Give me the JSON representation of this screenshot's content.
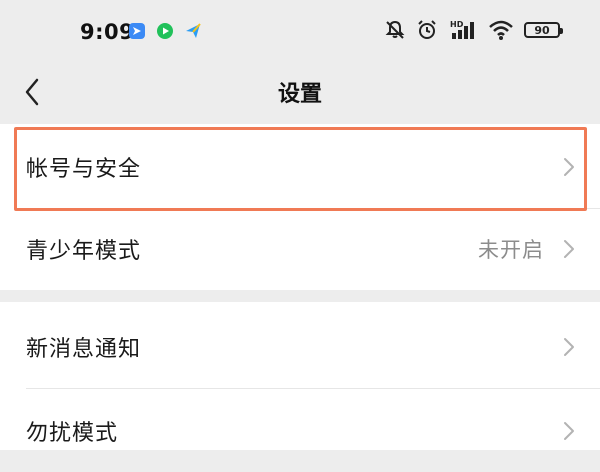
{
  "status_bar": {
    "time": "9:09",
    "battery": "90",
    "hd_label": "HD"
  },
  "nav": {
    "title": "设置"
  },
  "sections": [
    {
      "items": [
        {
          "label": "帐号与安全",
          "value": ""
        },
        {
          "label": "青少年模式",
          "value": "未开启"
        }
      ]
    },
    {
      "items": [
        {
          "label": "新消息通知",
          "value": ""
        },
        {
          "label": "勿扰模式",
          "value": ""
        }
      ]
    }
  ],
  "colors": {
    "background": "#ededed",
    "card": "#ffffff",
    "highlight": "#f07a55",
    "secondary_text": "#8c8c8c"
  }
}
